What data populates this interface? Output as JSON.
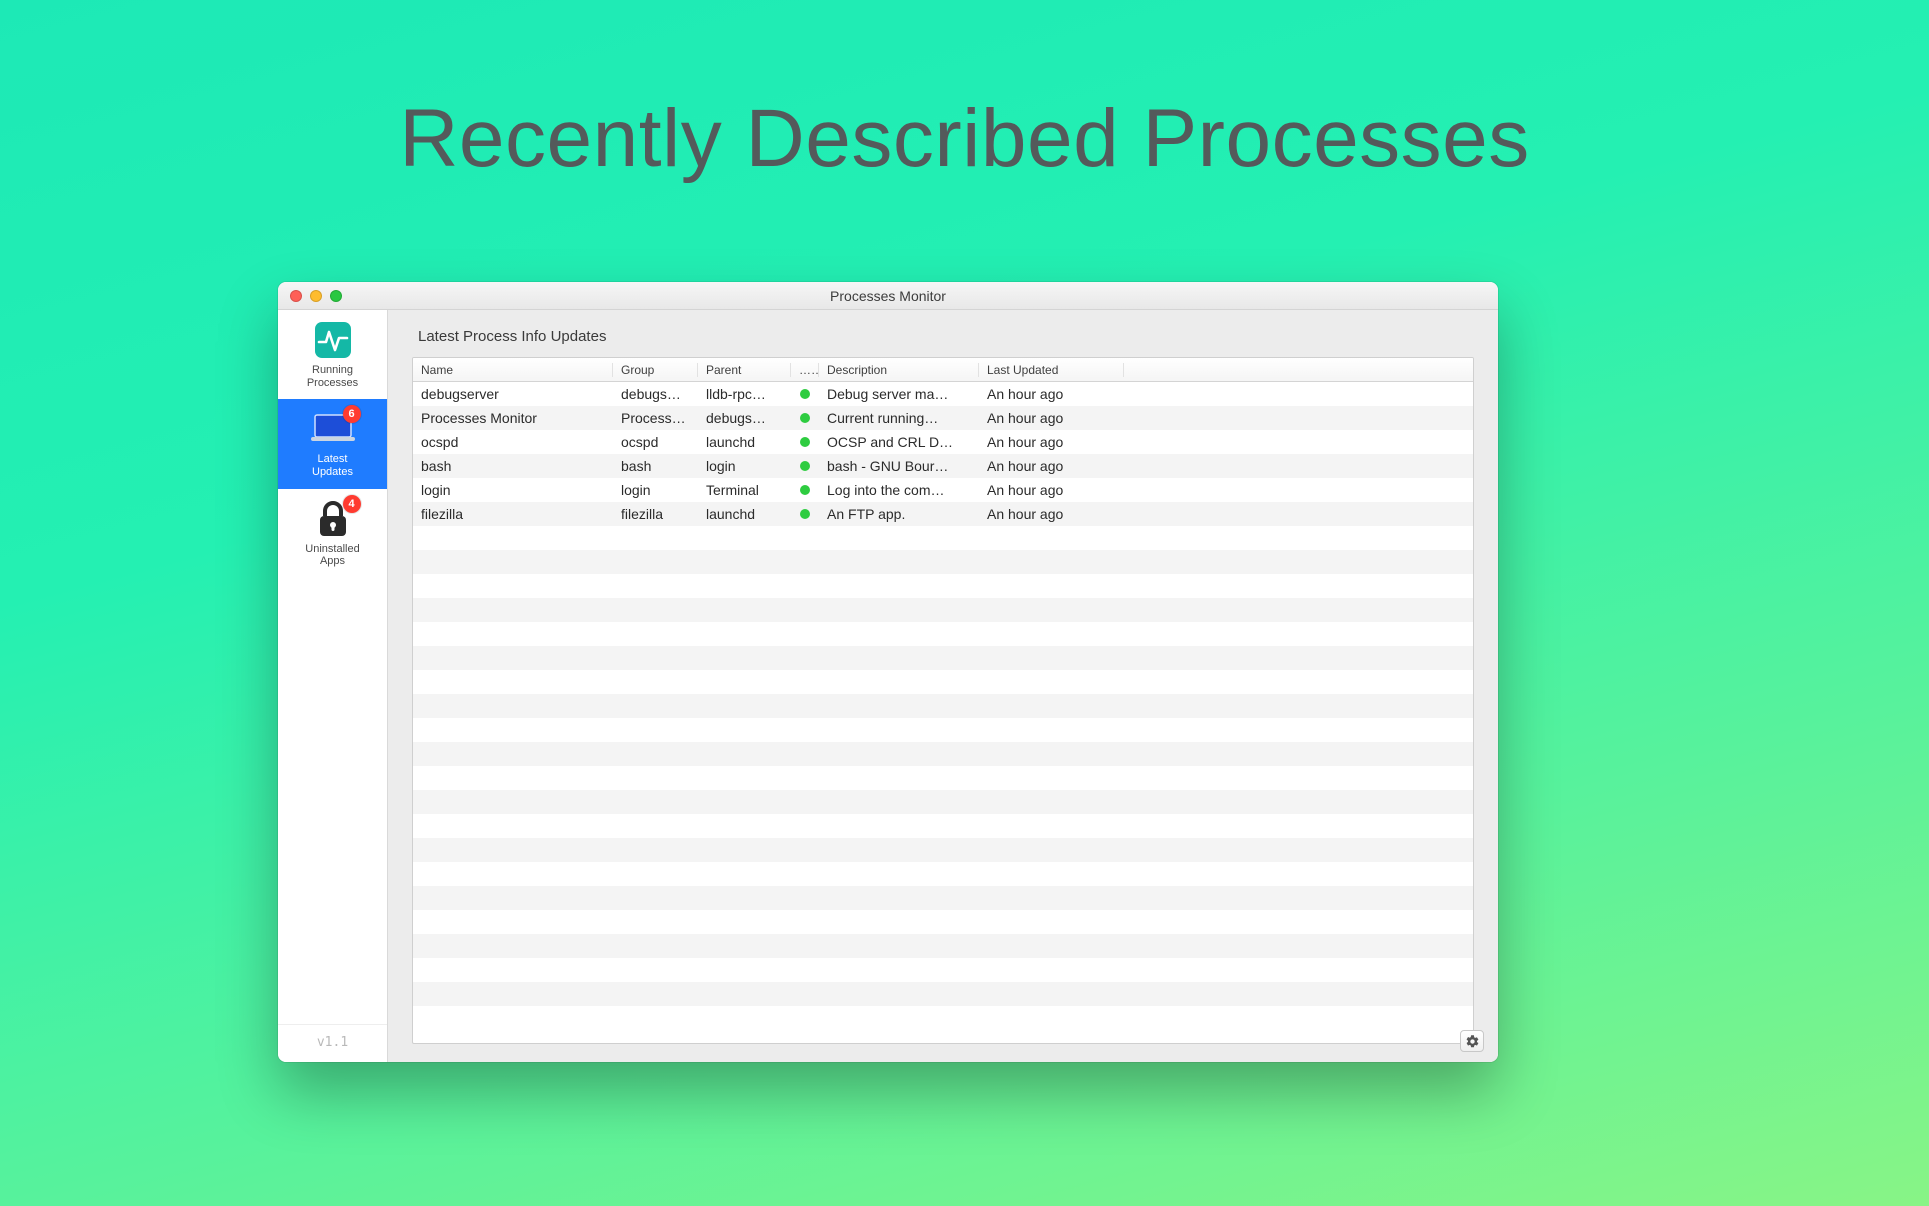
{
  "page_heading": "Recently Described Processes",
  "window": {
    "title": "Processes Monitor",
    "version_label": "v1.1"
  },
  "sidebar": {
    "items": [
      {
        "id": "running",
        "label_line1": "Running",
        "label_line2": "Processes",
        "badge": null,
        "selected": false
      },
      {
        "id": "latest",
        "label_line1": "Latest",
        "label_line2": "Updates",
        "badge": "6",
        "selected": true
      },
      {
        "id": "uninstalled",
        "label_line1": "Uninstalled",
        "label_line2": "Apps",
        "badge": "4",
        "selected": false
      }
    ]
  },
  "main": {
    "section_title": "Latest Process Info Updates",
    "columns": {
      "name": "Name",
      "group": "Group",
      "parent": "Parent",
      "status": "…",
      "description": "Description",
      "last_updated": "Last Updated"
    },
    "rows": [
      {
        "name": "debugserver",
        "group": "debugs…",
        "parent": "lldb-rpc…",
        "status": "green",
        "description": "Debug server ma…",
        "last_updated": "An hour ago"
      },
      {
        "name": "Processes Monitor",
        "group": "Process…",
        "parent": "debugs…",
        "status": "green",
        "description": "Current running…",
        "last_updated": "An hour ago"
      },
      {
        "name": "ocspd",
        "group": "ocspd",
        "parent": "launchd",
        "status": "green",
        "description": "OCSP and CRL D…",
        "last_updated": "An hour ago"
      },
      {
        "name": "bash",
        "group": "bash",
        "parent": "login",
        "status": "green",
        "description": "bash - GNU Bour…",
        "last_updated": "An hour ago"
      },
      {
        "name": "login",
        "group": "login",
        "parent": "Terminal",
        "status": "green",
        "description": "Log into the com…",
        "last_updated": "An hour ago"
      },
      {
        "name": "filezilla",
        "group": "filezilla",
        "parent": "launchd",
        "status": "green",
        "description": "An FTP app.",
        "last_updated": "An hour ago"
      }
    ]
  }
}
